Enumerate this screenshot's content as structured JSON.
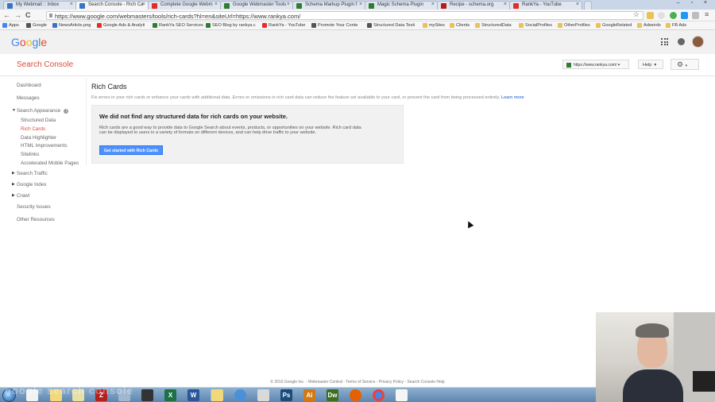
{
  "browser": {
    "tabs": [
      {
        "label": "My Webmail :: Inbox",
        "color": "#3b73c4"
      },
      {
        "label": "Search Console - Rich Ca",
        "color": "#3b73c4",
        "active": true
      },
      {
        "label": "Complete Google Webm",
        "color": "#e52d27"
      },
      {
        "label": "Google Webmaster Tools",
        "color": "#2e7d32"
      },
      {
        "label": "Schema Markup Plugin f",
        "color": "#2e7d32"
      },
      {
        "label": "Magic Schema Plugin",
        "color": "#2e7d32"
      },
      {
        "label": "Recipe - schema.org",
        "color": "#b71c1c"
      },
      {
        "label": "RankYa - YouTube",
        "color": "#e52d27"
      }
    ],
    "url": "https://www.google.com/webmasters/tools/rich-cards?hl=en&siteUrl=https://www.rankya.com/",
    "nav": {
      "back": "←",
      "forward": "→",
      "reload": "C",
      "star": "☆",
      "menu": "≡"
    },
    "window_controls": "– ▫ ×",
    "bookmarks": [
      {
        "label": "Apps",
        "color": "#4285f4"
      },
      {
        "label": "Google",
        "color": "#555555"
      },
      {
        "label": "NewsArticle.png",
        "color": "#3b73c4"
      },
      {
        "label": "Google Ads & Analyti",
        "color": "#e52d27"
      },
      {
        "label": "RankYa SEO Services",
        "color": "#2e7d32"
      },
      {
        "label": "SEO Blog by rankya.c",
        "color": "#2e7d32"
      },
      {
        "label": "RankYa - YouTube",
        "color": "#e52d27"
      },
      {
        "label": "Promote Your Conte",
        "color": "#555555"
      },
      {
        "label": "Structured Data Testi",
        "color": "#555555"
      },
      {
        "label": "mySites",
        "color": "#e8c25a"
      },
      {
        "label": "Clients",
        "color": "#e8c25a"
      },
      {
        "label": "StructuredData",
        "color": "#e8c25a"
      },
      {
        "label": "SocialProfiles",
        "color": "#e8c25a"
      },
      {
        "label": "OtherProfiles",
        "color": "#e8c25a"
      },
      {
        "label": "GoogleRelated",
        "color": "#e8c25a"
      },
      {
        "label": "Adwords",
        "color": "#e8c25a"
      },
      {
        "label": "FB Ads",
        "color": "#e8c25a"
      }
    ]
  },
  "header": {
    "logo": "Google",
    "apps_icon": "apps-grid-icon",
    "notifications_icon": "notifications-icon"
  },
  "console": {
    "title": "Search Console",
    "site": "https://www.rankya.com/",
    "help_label": "Help",
    "settings_icon": "gear-icon"
  },
  "sidebar": {
    "dashboard": "Dashboard",
    "messages": "Messages",
    "search_appearance": "Search Appearance",
    "structured_data": "Structured Data",
    "rich_cards": "Rich Cards",
    "data_highlighter": "Data Highlighter",
    "html_improvements": "HTML Improvements",
    "sitelinks": "Sitelinks",
    "amp": "Accelerated Mobile Pages",
    "search_traffic": "Search Traffic",
    "google_index": "Google Index",
    "crawl": "Crawl",
    "security_issues": "Security Issues",
    "other_resources": "Other Resources"
  },
  "main": {
    "title": "Rich Cards",
    "description": "Fix errors in your rich cards or enhance your cards with additional data. Errors or omissions in rich card data can reduce the feature set available to your card, or prevent the card from being processed entirely.",
    "learn_more": "Learn more",
    "card_title": "We did not find any structured data for rich cards on your website.",
    "card_text": "Rich cards are a good way to provide data to Google Search about events, products, or opportunities on your website. Rich card data can be displayed to users in a variety of formats on different devices, and can help drive traffic to your website.",
    "cta_label": "Get started with Rich Cards"
  },
  "footer": {
    "text": "© 2016 Google Inc. - Webmaster Central - Terms of Service - Privacy Policy - Search Console Help"
  },
  "taskbar": {
    "watermark": "google search console",
    "icons": [
      {
        "name": "explorer-icon",
        "label": "",
        "color": "#f2f2f2"
      },
      {
        "name": "folder-icon",
        "label": "",
        "color": "#f1d87a"
      },
      {
        "name": "sticky-notes-icon",
        "label": "",
        "color": "#e7e0a8"
      },
      {
        "name": "filezilla-icon",
        "label": "Z",
        "color": "#b32020"
      },
      {
        "name": "snipping-tool-icon",
        "label": "",
        "color": "#9fb8d0"
      },
      {
        "name": "camera-icon",
        "label": "",
        "color": "#333333"
      },
      {
        "name": "excel-icon",
        "label": "X",
        "color": "#1e7145"
      },
      {
        "name": "word-icon",
        "label": "W",
        "color": "#2b579a"
      },
      {
        "name": "notepad-icon",
        "label": "",
        "color": "#9dc3e6"
      },
      {
        "name": "folder-icon",
        "label": "",
        "color": "#f1d87a"
      },
      {
        "name": "media-player-icon",
        "label": "",
        "color": "#4a90d9"
      },
      {
        "name": "pdf-icon",
        "label": "",
        "color": "#d9d9d9"
      },
      {
        "name": "photoshop-icon",
        "label": "Ps",
        "color": "#1c4b7a"
      },
      {
        "name": "illustrator-icon",
        "label": "Ai",
        "color": "#d07a16"
      },
      {
        "name": "dreamweaver-icon",
        "label": "Dw",
        "color": "#3f6e1f"
      },
      {
        "name": "firefox-icon",
        "label": "",
        "color": "#e66000"
      },
      {
        "name": "chrome-icon",
        "label": "",
        "color": "#4285f4"
      },
      {
        "name": "blank-window-icon",
        "label": "",
        "color": "#f5f5f5"
      }
    ]
  },
  "colors": {
    "accent_red": "#dd4b39",
    "link_blue": "#1a55c8",
    "button_blue": "#4d90fe"
  }
}
